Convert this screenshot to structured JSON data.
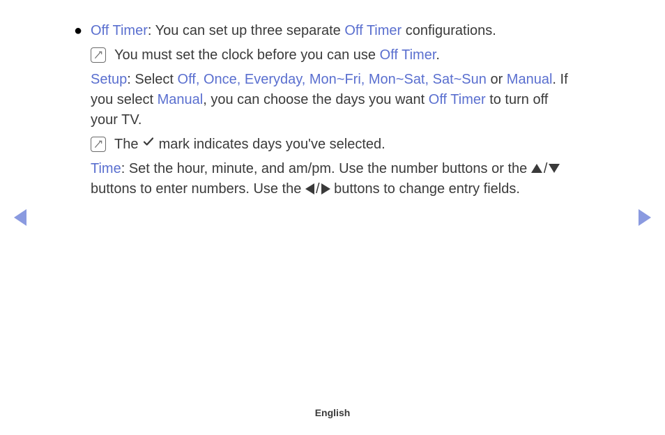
{
  "bullet_label": "Off Timer",
  "bullet_text_1": ": You can set up three separate ",
  "bullet_label_2": "Off Timer",
  "bullet_text_2": " configurations.",
  "note1_text_1": "You must set the clock before you can use ",
  "note1_kw": "Off Timer",
  "note1_text_2": ".",
  "setup_label": "Setup",
  "setup_text_1": ": Select ",
  "setup_options": "Off, Once, Everyday, Mon~Fri, Mon~Sat, Sat~Sun",
  "setup_text_2": " or ",
  "setup_manual": "Manual",
  "setup_text_3": ". If you select ",
  "setup_manual_2": "Manual",
  "setup_text_4": ", you can choose the days you want ",
  "setup_offtimer": "Off Timer",
  "setup_text_5": " to turn off your TV.",
  "note2_text_1": "The ",
  "note2_text_2": " mark indicates days you've selected.",
  "time_label": "Time",
  "time_text_1": ": Set the hour, minute, and am/pm. Use the number buttons or the ",
  "time_text_2": " buttons to enter numbers. Use the ",
  "time_text_3": " buttons to change entry fields.",
  "slash": "/",
  "footer": "English"
}
